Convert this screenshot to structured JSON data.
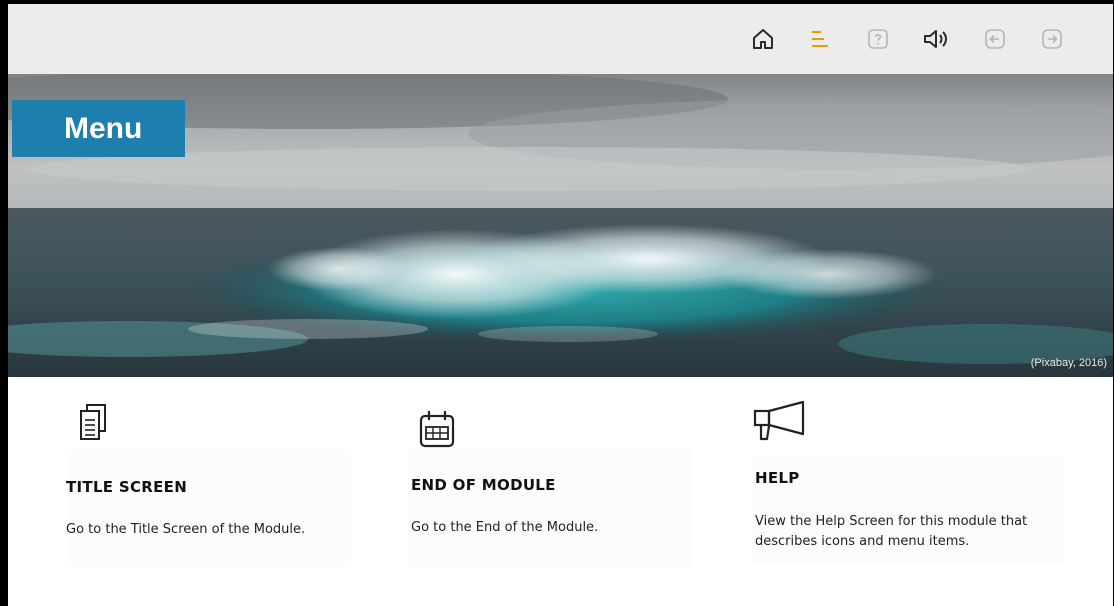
{
  "toolbar": {
    "items": [
      {
        "name": "home-icon",
        "color": "#2b2b2b"
      },
      {
        "name": "menu-icon",
        "color": "#e0a100"
      },
      {
        "name": "help-icon",
        "color": "#b5b5b5"
      },
      {
        "name": "audio-icon",
        "color": "#2b2b2b"
      },
      {
        "name": "back-icon",
        "color": "#b5b5b5"
      },
      {
        "name": "forward-icon",
        "color": "#b5b5b5"
      }
    ]
  },
  "hero": {
    "title": "Menu",
    "credit": "(Pixabay, 2016)",
    "accent": "#1e7fae"
  },
  "cards": [
    {
      "icon": "documents-icon",
      "title": "TITLE SCREEN",
      "description": "Go to the Title Screen of the Module."
    },
    {
      "icon": "calendar-icon",
      "title": "END OF MODULE",
      "description": "Go to the End of the Module."
    },
    {
      "icon": "megaphone-icon",
      "title": "HELP",
      "description": "View the Help Screen for this module that describes icons and menu items."
    }
  ]
}
